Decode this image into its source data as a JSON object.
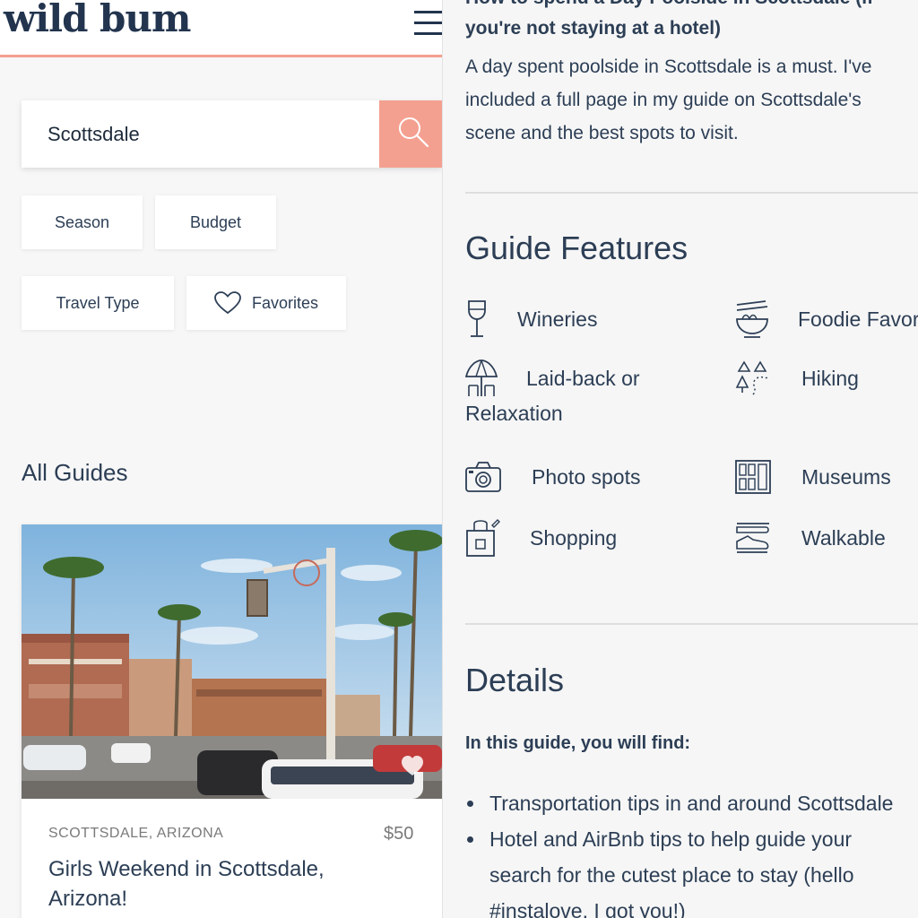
{
  "left_panel": {
    "header": {
      "logo": "wild bum"
    },
    "search": {
      "value": "Scottsdale"
    },
    "filters": {
      "season": "Season",
      "budget": "Budget",
      "travel_type": "Travel Type",
      "favorites": "Favorites"
    },
    "all_guides_heading": "All Guides",
    "guide_card": {
      "location": "SCOTTSDALE, ARIZONA",
      "price": "$50",
      "title": "Girls Weekend in Scottsdale, Arizona!"
    }
  },
  "right_panel": {
    "intro_heading_cut": "How to spend a Day Poolside in Scottsdale (if",
    "intro_heading_tail": "you're not staying at a hotel)",
    "intro_paragraph": "A day spent poolside in Scottsdale is a must. I've\nincluded a full page in my guide on Scottsdale's\nscene and the best spots to visit.",
    "guide_features_heading": "Guide Features",
    "features": [
      {
        "label": "Wineries",
        "icon": "wine-glass-icon"
      },
      {
        "label": "Foodie Favorites",
        "icon": "noodle-bowl-icon"
      },
      {
        "label": "Laid-back or",
        "label_line2": "Relaxation",
        "icon": "beach-umbrella-icon"
      },
      {
        "label": "Hiking",
        "icon": "hiking-trail-icon"
      },
      {
        "label": "Photo spots",
        "icon": "camera-icon"
      },
      {
        "label": "Museums",
        "icon": "museum-icon"
      },
      {
        "label": "Shopping",
        "icon": "shopping-bag-icon"
      },
      {
        "label": "Walkable",
        "icon": "sneaker-icon"
      }
    ],
    "details_heading": "Details",
    "details_lead": "In this guide, you will find:",
    "details_bullets": [
      "Transportation tips in and around Scottsdale",
      "Hotel and AirBnb tips to help guide your\nsearch for the cutest place to stay (hello\n#instalove, I got you!)"
    ]
  },
  "colors": {
    "accent": "#f4a090",
    "text_dark": "#2c3e55",
    "logo_navy": "#22344e"
  }
}
